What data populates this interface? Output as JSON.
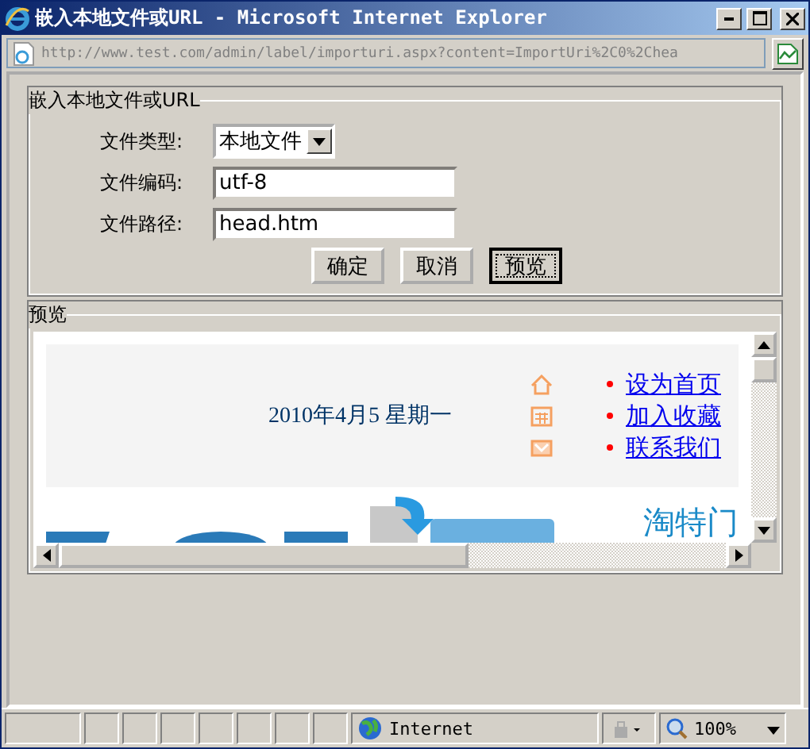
{
  "window": {
    "title": "嵌入本地文件或URL - Microsoft Internet Explorer"
  },
  "address": {
    "url": "http://www.test.com/admin/label/importuri.aspx?content=ImportUri%2C0%2Chea"
  },
  "form": {
    "legend": "嵌入本地文件或URL",
    "fields": [
      {
        "label": "文件类型:",
        "kind": "select",
        "value": "本地文件"
      },
      {
        "label": "文件编码:",
        "kind": "text",
        "value": "utf-8"
      },
      {
        "label": "文件路径:",
        "kind": "text",
        "value": "head.htm"
      }
    ],
    "buttons": [
      {
        "label": "确定",
        "focused": false
      },
      {
        "label": "取消",
        "focused": false
      },
      {
        "label": "预览",
        "focused": true
      }
    ]
  },
  "preview": {
    "legend": "预览",
    "date": "2010年4月5 星期一",
    "links": [
      {
        "label": "设为首页",
        "kind": "home"
      },
      {
        "label": "加入收藏",
        "kind": "grid"
      },
      {
        "label": "联系我们",
        "kind": "mail"
      }
    ],
    "banner_text": "淘特门"
  },
  "status_bar": {
    "zone": "Internet",
    "zoom": "100%"
  }
}
